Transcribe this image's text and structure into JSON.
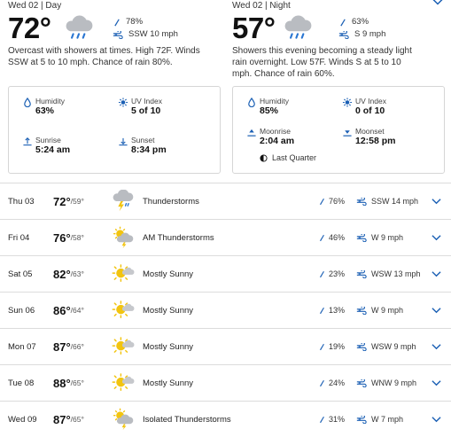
{
  "day": {
    "header": "Wed 02 | Day",
    "temp": "72°",
    "precip": "78%",
    "wind": "SSW 10 mph",
    "narrative": "Overcast with showers at times. High 72F. Winds SSW at 5 to 10 mph. Chance of rain 80%.",
    "humidity_label": "Humidity",
    "humidity": "63%",
    "uv_label": "UV Index",
    "uv": "5 of 10",
    "sunrise_label": "Sunrise",
    "sunrise": "5:24 am",
    "sunset_label": "Sunset",
    "sunset": "8:34 pm",
    "icon": "cloud-rain-icon"
  },
  "night": {
    "header": "Wed 02 | Night",
    "temp": "57°",
    "precip": "63%",
    "wind": "S 9 mph",
    "narrative": "Showers this evening becoming a steady light rain overnight. Low 57F. Winds S at 5 to 10 mph. Chance of rain 60%.",
    "humidity_label": "Humidity",
    "humidity": "85%",
    "uv_label": "UV Index",
    "uv": "0 of 10",
    "moonrise_label": "Moonrise",
    "moonrise": "2:04 am",
    "moonset_label": "Moonset",
    "moonset": "12:58 pm",
    "moon_phase": "Last Quarter",
    "icon": "cloud-rain-icon"
  },
  "daily": [
    {
      "date": "Thu 03",
      "hi": "72°",
      "lo": "/59°",
      "icon": "thunderstorm-icon",
      "cond": "Thunderstorms",
      "precip": "76%",
      "wind": "SSW 14 mph"
    },
    {
      "date": "Fri 04",
      "hi": "76°",
      "lo": "/58°",
      "icon": "sun-thunderstorm-icon",
      "cond": "AM Thunderstorms",
      "precip": "46%",
      "wind": "W 9 mph"
    },
    {
      "date": "Sat 05",
      "hi": "82°",
      "lo": "/63°",
      "icon": "mostly-sunny-icon",
      "cond": "Mostly Sunny",
      "precip": "23%",
      "wind": "WSW 13 mph"
    },
    {
      "date": "Sun 06",
      "hi": "86°",
      "lo": "/64°",
      "icon": "mostly-sunny-icon",
      "cond": "Mostly Sunny",
      "precip": "13%",
      "wind": "W 9 mph"
    },
    {
      "date": "Mon 07",
      "hi": "87°",
      "lo": "/66°",
      "icon": "mostly-sunny-icon",
      "cond": "Mostly Sunny",
      "precip": "19%",
      "wind": "WSW 9 mph"
    },
    {
      "date": "Tue 08",
      "hi": "88°",
      "lo": "/65°",
      "icon": "mostly-sunny-icon",
      "cond": "Mostly Sunny",
      "precip": "24%",
      "wind": "WNW 9 mph"
    },
    {
      "date": "Wed 09",
      "hi": "87°",
      "lo": "/65°",
      "icon": "sun-thunderstorm-icon",
      "cond": "Isolated Thunderstorms",
      "precip": "31%",
      "wind": "W 7 mph"
    }
  ],
  "colors": {
    "accent": "#1a5fb4",
    "sun": "#f2c40f",
    "cloud": "#b9bcc1",
    "rain": "#2a76d2",
    "text": "#222222"
  }
}
